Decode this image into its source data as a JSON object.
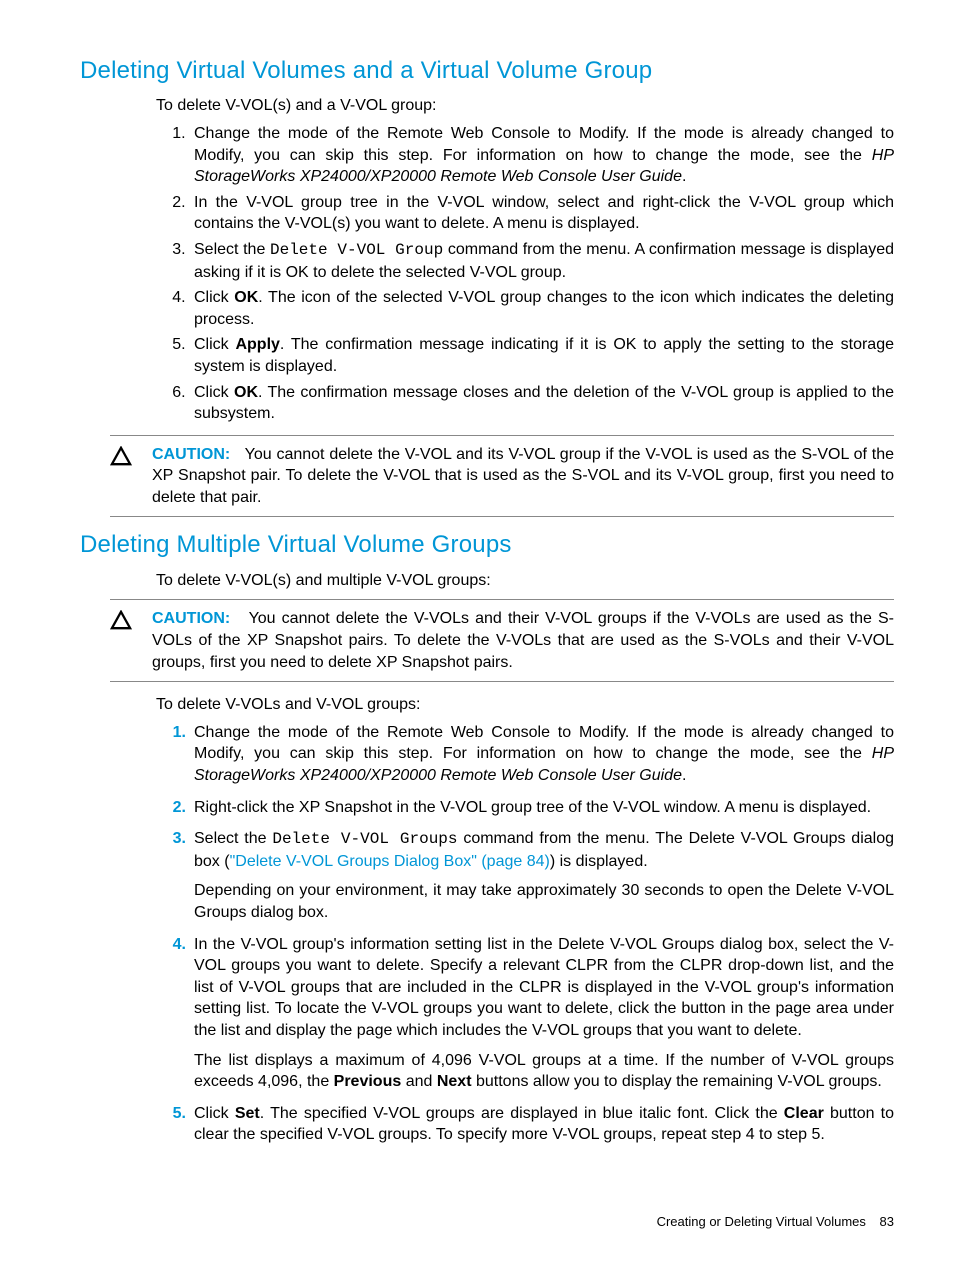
{
  "section1": {
    "heading": "Deleting Virtual Volumes and a Virtual Volume Group",
    "intro": "To delete V-VOL(s) and a V-VOL group:",
    "steps": {
      "s1a": "Change the mode of the Remote Web Console to Modify. If the mode is already changed to Modify, you can skip this step. For information on how to change the mode, see the ",
      "s1b": "HP StorageWorks XP24000/XP20000 Remote Web Console User Guide",
      "s1c": ".",
      "s2": "In the V-VOL group tree in the V-VOL window, select and right-click the V-VOL group which contains the V-VOL(s) you want to delete. A menu is displayed.",
      "s3a": "Select the ",
      "s3b": "Delete V-VOL Group",
      "s3c": " command from the menu. A confirmation message is displayed asking if it is OK to delete the selected V-VOL group.",
      "s4a": "Click ",
      "s4b": "OK",
      "s4c": ". The icon of the selected V-VOL group changes to the icon which indicates the deleting process.",
      "s5a": "Click ",
      "s5b": "Apply",
      "s5c": ". The confirmation message indicating if it is OK to apply the setting to the storage system is displayed.",
      "s6a": "Click ",
      "s6b": "OK",
      "s6c": ". The confirmation message closes and the deletion of the V-VOL group is applied to the subsystem."
    },
    "caution_label": "CAUTION:",
    "caution_text": "You cannot delete the V-VOL and its V-VOL group if the V-VOL is used as the S-VOL of the XP Snapshot pair. To delete the V-VOL that is used as the S-VOL and its V-VOL group, first you need to delete that pair."
  },
  "section2": {
    "heading": "Deleting Multiple Virtual Volume Groups",
    "intro": "To delete V-VOL(s) and multiple V-VOL groups:",
    "caution_label": "CAUTION:",
    "caution_text": "You cannot delete the V-VOLs and their V-VOL groups if the V-VOLs are used as the S-VOLs of the XP Snapshot pairs. To delete the V-VOLs that are used as the S-VOLs and their V-VOL groups, first you need to delete XP Snapshot pairs.",
    "intro2": "To delete V-VOLs and V-VOL groups:",
    "steps": {
      "s1a": "Change the mode of the Remote Web Console to Modify. If the mode is already changed to Modify, you can skip this step. For information on how to change the mode, see the ",
      "s1b": "HP StorageWorks XP24000/XP20000 Remote Web Console User Guide",
      "s1c": ".",
      "s2": "Right-click the XP Snapshot in the V-VOL group tree of the V-VOL window. A menu is displayed.",
      "s3a": "Select the ",
      "s3b": "Delete V-VOL Groups",
      "s3c": " command from the menu. The Delete V-VOL Groups dialog box (",
      "s3d": "\"Delete V-VOL Groups Dialog Box\" (page 84)",
      "s3e": ") is displayed.",
      "s3f": "Depending on your environment, it may take approximately 30 seconds to open the Delete V-VOL Groups dialog box.",
      "s4a": "In the V-VOL group's information setting list in the Delete V-VOL Groups dialog box, select the V-VOL groups you want to delete. Specify a relevant CLPR from the CLPR drop-down list, and the list of V-VOL groups that are included in the CLPR is displayed in the V-VOL group's information setting list. To locate the V-VOL groups you want to delete, click the button in the page area under the list and display the page which includes the V-VOL groups that you want to delete.",
      "s4b1": "The list displays a maximum of 4,096 V-VOL groups at a time. If the number of V-VOL groups exceeds 4,096, the ",
      "s4b2": "Previous",
      "s4b3": " and ",
      "s4b4": "Next",
      "s4b5": " buttons allow you to display the remaining V-VOL groups.",
      "s5a": "Click ",
      "s5b": "Set",
      "s5c": ". The specified V-VOL groups are displayed in blue italic font. Click the ",
      "s5d": "Clear",
      "s5e": " button to clear the specified V-VOL groups. To specify more V-VOL groups, repeat step 4 to step 5."
    }
  },
  "footer": {
    "title": "Creating or Deleting Virtual Volumes",
    "page": "83"
  }
}
